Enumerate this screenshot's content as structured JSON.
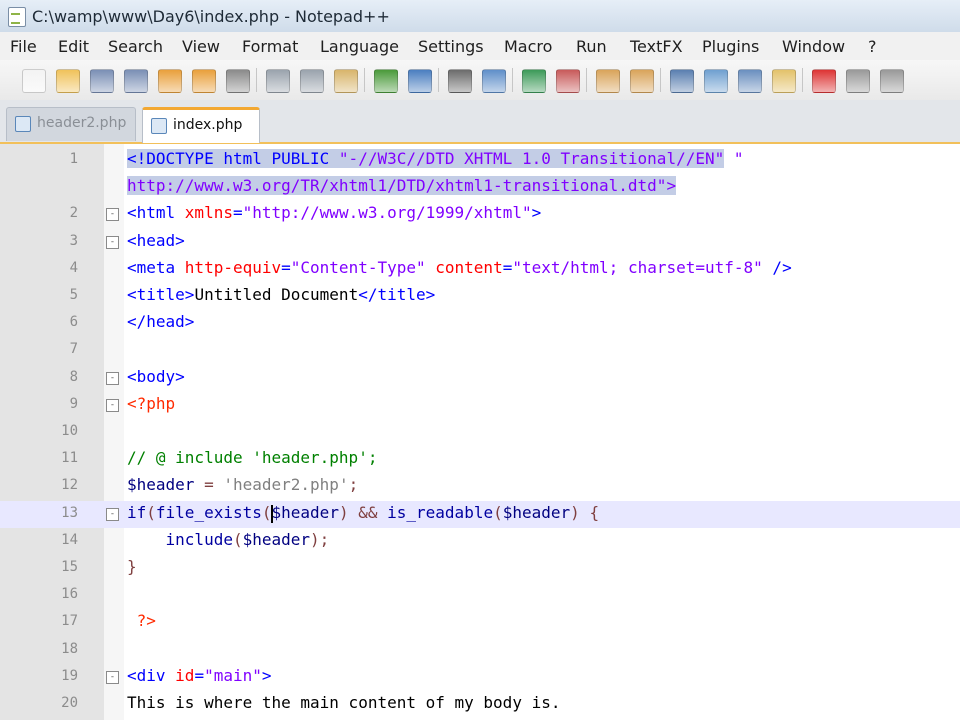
{
  "window": {
    "title": "C:\\wamp\\www\\Day6\\index.php - Notepad++"
  },
  "menu": [
    "File",
    "Edit",
    "Search",
    "View",
    "Format",
    "Language",
    "Settings",
    "Macro",
    "Run",
    "TextFX",
    "Plugins",
    "Window",
    "?"
  ],
  "toolbar": [
    "new-icon",
    "open-icon",
    "save-icon",
    "save-all-icon",
    "close-icon",
    "close-all-icon",
    "print-icon",
    "cut-icon",
    "copy-icon",
    "paste-icon",
    "undo-icon",
    "redo-icon",
    "find-icon",
    "replace-icon",
    "zoom-in-icon",
    "zoom-out-icon",
    "sync-vertical-icon",
    "sync-horizontal-icon",
    "word-wrap-icon",
    "show-all-chars-icon",
    "indent-guide-icon",
    "user-lang-icon",
    "record-macro-icon",
    "stop-macro-icon",
    "play-macro-icon"
  ],
  "tabs": [
    {
      "label": "header2.php",
      "active": false
    },
    {
      "label": "index.php",
      "active": true
    }
  ],
  "lines": [
    {
      "num": "1",
      "fold": "",
      "segments": [
        {
          "t": "<!DOCTYPE html PUBLIC ",
          "c": "t-doc sel"
        },
        {
          "t": "\"-//W3C//DTD XHTML 1.0 Transitional//EN\"",
          "c": "t-str sel"
        },
        {
          "t": " \"",
          "c": "t-str"
        }
      ]
    },
    {
      "num": "",
      "fold": "",
      "segments": [
        {
          "t": "http://www.w3.org/TR/xhtml1/DTD/xhtml1-transitional.dtd\">",
          "c": "t-str sel"
        }
      ]
    },
    {
      "num": "2",
      "fold": "-",
      "segments": [
        {
          "t": "<html ",
          "c": "t-tag"
        },
        {
          "t": "xmlns",
          "c": "t-attr"
        },
        {
          "t": "=",
          "c": "t-tag"
        },
        {
          "t": "\"http://www.w3.org/1999/xhtml\"",
          "c": "t-str"
        },
        {
          "t": ">",
          "c": "t-tag"
        }
      ]
    },
    {
      "num": "3",
      "fold": "-",
      "segments": [
        {
          "t": "<head>",
          "c": "t-tag"
        }
      ]
    },
    {
      "num": "4",
      "fold": "",
      "segments": [
        {
          "t": "<meta ",
          "c": "t-tag"
        },
        {
          "t": "http-equiv",
          "c": "t-attr"
        },
        {
          "t": "=",
          "c": "t-tag"
        },
        {
          "t": "\"Content-Type\"",
          "c": "t-str"
        },
        {
          "t": " ",
          "c": ""
        },
        {
          "t": "content",
          "c": "t-attr"
        },
        {
          "t": "=",
          "c": "t-tag"
        },
        {
          "t": "\"text/html; charset=utf-8\"",
          "c": "t-str"
        },
        {
          "t": " />",
          "c": "t-tag"
        }
      ]
    },
    {
      "num": "5",
      "fold": "",
      "segments": [
        {
          "t": "<title>",
          "c": "t-tag"
        },
        {
          "t": "Untitled Document",
          "c": ""
        },
        {
          "t": "</title>",
          "c": "t-tag"
        }
      ]
    },
    {
      "num": "6",
      "fold": "",
      "segments": [
        {
          "t": "</head>",
          "c": "t-tag"
        }
      ]
    },
    {
      "num": "7",
      "fold": "",
      "segments": []
    },
    {
      "num": "8",
      "fold": "-",
      "segments": [
        {
          "t": "<body>",
          "c": "t-tag"
        }
      ]
    },
    {
      "num": "9",
      "fold": "-",
      "segments": [
        {
          "t": "<?php",
          "c": "t-php"
        }
      ]
    },
    {
      "num": "10",
      "fold": "",
      "segments": []
    },
    {
      "num": "11",
      "fold": "",
      "segments": [
        {
          "t": "// @ include 'header.php';",
          "c": "t-cm"
        }
      ]
    },
    {
      "num": "12",
      "fold": "",
      "segments": [
        {
          "t": "$header",
          "c": "t-var"
        },
        {
          "t": " = ",
          "c": "t-op"
        },
        {
          "t": "'header2.php'",
          "c": "t-sstr"
        },
        {
          "t": ";",
          "c": "t-op"
        }
      ]
    },
    {
      "num": "13",
      "fold": "-",
      "current": true,
      "segments": [
        {
          "t": "if",
          "c": "t-kw"
        },
        {
          "t": "(",
          "c": "t-op"
        },
        {
          "t": "file_exists",
          "c": "t-kw"
        },
        {
          "t": "(",
          "c": "t-op"
        },
        {
          "t": "CARET",
          "c": "caret"
        },
        {
          "t": "$header",
          "c": "t-var"
        },
        {
          "t": ") && ",
          "c": "t-op"
        },
        {
          "t": "is_readable",
          "c": "t-kw"
        },
        {
          "t": "(",
          "c": "t-op"
        },
        {
          "t": "$header",
          "c": "t-var"
        },
        {
          "t": ") {",
          "c": "t-op"
        }
      ]
    },
    {
      "num": "14",
      "fold": "",
      "segments": [
        {
          "t": "    ",
          "c": ""
        },
        {
          "t": "include",
          "c": "t-kw"
        },
        {
          "t": "(",
          "c": "t-op"
        },
        {
          "t": "$header",
          "c": "t-var"
        },
        {
          "t": ");",
          "c": "t-op"
        }
      ]
    },
    {
      "num": "15",
      "fold": "",
      "segments": [
        {
          "t": "}",
          "c": "t-op"
        }
      ]
    },
    {
      "num": "16",
      "fold": "",
      "segments": []
    },
    {
      "num": "17",
      "fold": "",
      "segments": [
        {
          "t": " ?>",
          "c": "t-php"
        }
      ]
    },
    {
      "num": "18",
      "fold": "",
      "segments": []
    },
    {
      "num": "19",
      "fold": "-",
      "segments": [
        {
          "t": "<div ",
          "c": "t-tag"
        },
        {
          "t": "id",
          "c": "t-attr"
        },
        {
          "t": "=",
          "c": "t-tag"
        },
        {
          "t": "\"main\"",
          "c": "t-str"
        },
        {
          "t": ">",
          "c": "t-tag"
        }
      ]
    },
    {
      "num": "20",
      "fold": "",
      "segments": [
        {
          "t": "This is where the main content of my body is.",
          "c": ""
        }
      ]
    }
  ]
}
